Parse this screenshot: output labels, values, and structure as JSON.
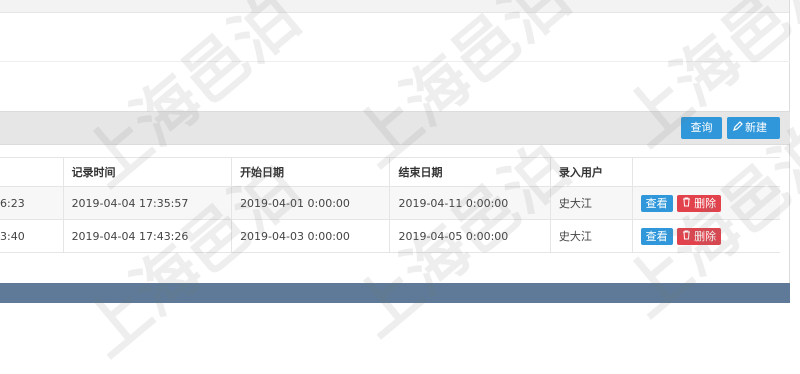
{
  "toolbar": {
    "query_label": "查询",
    "new_label": "新建",
    "new_icon": "pencil-icon"
  },
  "table": {
    "headers": [
      "",
      "记录时间",
      "开始日期",
      "结束日期",
      "录入用户",
      ""
    ],
    "rows": [
      {
        "col0": "6:23",
        "record_time": "2019-04-04 17:35:57",
        "start_date": "2019-04-01 0:00:00",
        "end_date": "2019-04-11 0:00:00",
        "user": "史大江",
        "view_label": "查看",
        "delete_label": "删除"
      },
      {
        "col0": "3:40",
        "record_time": "2019-04-04 17:43:26",
        "start_date": "2019-04-03 0:00:00",
        "end_date": "2019-04-05 0:00:00",
        "user": "史大江",
        "view_label": "查看",
        "delete_label": "删除"
      }
    ]
  },
  "watermark": {
    "text": "上海邑泊"
  },
  "colors": {
    "primary": "#2f97da",
    "danger": "#e2424c",
    "footer": "#5e7a98",
    "toolbar_bg": "#e6e6e6"
  }
}
